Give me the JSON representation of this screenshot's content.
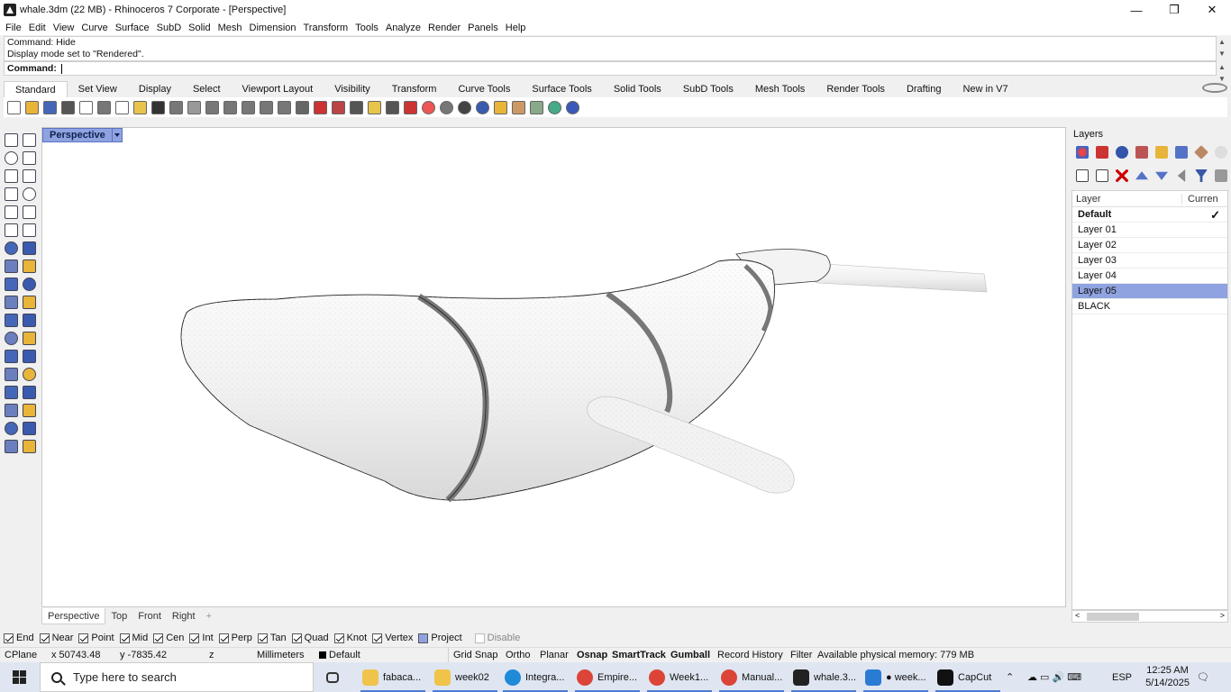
{
  "window": {
    "title": "whale.3dm (22 MB) - Rhinoceros 7 Corporate - [Perspective]",
    "controls": [
      "—",
      "❐",
      "✕"
    ]
  },
  "menu": [
    "File",
    "Edit",
    "View",
    "Curve",
    "Surface",
    "SubD",
    "Solid",
    "Mesh",
    "Dimension",
    "Transform",
    "Tools",
    "Analyze",
    "Render",
    "Panels",
    "Help"
  ],
  "command": {
    "history": [
      "Command: Hide",
      "Display mode set to \"Rendered\"."
    ],
    "prompt": "Command:",
    "value": ""
  },
  "toolbar_tabs": [
    "Standard",
    "Set View",
    "Display",
    "Select",
    "Viewport Layout",
    "Visibility",
    "Transform",
    "Curve Tools",
    "Surface Tools",
    "Solid Tools",
    "SubD Tools",
    "Mesh Tools",
    "Render Tools",
    "Drafting",
    "New in V7"
  ],
  "toolbar_active": "Standard",
  "toolbar_icons": [
    "new-icon",
    "open-icon",
    "save-icon",
    "print-icon",
    "import-icon",
    "cut-icon",
    "copy-icon",
    "paste-icon",
    "undo-icon",
    "pan-icon",
    "move-icon",
    "zoom-icon",
    "zoom-window-icon",
    "zoom-extents-icon",
    "zoom-selected-icon",
    "rotate-view-icon",
    "viewport-grid-icon",
    "hide-icon",
    "show-icon",
    "lock-icon",
    "light-icon",
    "lock2-icon",
    "layer-icon",
    "material-icon",
    "render-sphere-icon",
    "environment-icon",
    "render-icon",
    "osnap-icon",
    "gear-tools-icon",
    "grid-icon",
    "rhino-help-icon",
    "about-icon"
  ],
  "viewport": {
    "label": "Perspective",
    "tabs": [
      "Perspective",
      "Top",
      "Front",
      "Right"
    ],
    "add_tab": "+"
  },
  "layers": {
    "title": "Layers",
    "col_layer": "Layer",
    "col_current": "Curren",
    "rows": [
      {
        "name": "Default",
        "current": true,
        "bold": true,
        "selected": false
      },
      {
        "name": "Layer 01",
        "current": false,
        "bold": false,
        "selected": false
      },
      {
        "name": "Layer 02",
        "current": false,
        "bold": false,
        "selected": false
      },
      {
        "name": "Layer 03",
        "current": false,
        "bold": false,
        "selected": false
      },
      {
        "name": "Layer 04",
        "current": false,
        "bold": false,
        "selected": false
      },
      {
        "name": "Layer 05",
        "current": false,
        "bold": false,
        "selected": true
      },
      {
        "name": "BLACK",
        "current": false,
        "bold": false,
        "selected": false
      }
    ]
  },
  "osnap": [
    {
      "label": "End",
      "checked": true
    },
    {
      "label": "Near",
      "checked": true
    },
    {
      "label": "Point",
      "checked": true
    },
    {
      "label": "Mid",
      "checked": true
    },
    {
      "label": "Cen",
      "checked": true
    },
    {
      "label": "Int",
      "checked": true
    },
    {
      "label": "Perp",
      "checked": true
    },
    {
      "label": "Tan",
      "checked": true
    },
    {
      "label": "Quad",
      "checked": true
    },
    {
      "label": "Knot",
      "checked": true
    },
    {
      "label": "Vertex",
      "checked": true
    },
    {
      "label": "Project",
      "checked": false
    },
    {
      "label": "Disable",
      "checked": false
    }
  ],
  "status": {
    "cplane": "CPlane",
    "x": "x 50743.48",
    "y": "y -7835.42",
    "z": "z",
    "units": "Millimeters",
    "layer": "Default",
    "grid_snap": "Grid Snap",
    "ortho": "Ortho",
    "planar": "Planar",
    "osnap": "Osnap",
    "smarttrack": "SmartTrack",
    "gumball": "Gumball",
    "record_history": "Record History",
    "filter": "Filter",
    "memory": "Available physical memory: 779 MB"
  },
  "taskbar": {
    "search_placeholder": "Type here to search",
    "apps": [
      {
        "label": "",
        "icon": "task-view-icon"
      },
      {
        "label": "fabaca...",
        "icon": "folder-icon"
      },
      {
        "label": "week02",
        "icon": "folder-icon"
      },
      {
        "label": "Integra...",
        "icon": "edge-icon"
      },
      {
        "label": "Empire...",
        "icon": "chrome-icon"
      },
      {
        "label": "Week1...",
        "icon": "chrome-icon"
      },
      {
        "label": "Manual...",
        "icon": "chrome-icon"
      },
      {
        "label": "whale.3...",
        "icon": "rhino-icon"
      },
      {
        "label": "● week...",
        "icon": "vscode-icon"
      },
      {
        "label": "CapCut",
        "icon": "capcut-icon"
      }
    ],
    "language": "ESP",
    "time": "12:25 AM",
    "date": "5/14/2025"
  },
  "colors": {
    "accent": "#8fa3e0",
    "viewport_bg": "#ffffff",
    "taskbar_bg": "#dfe6f1"
  }
}
